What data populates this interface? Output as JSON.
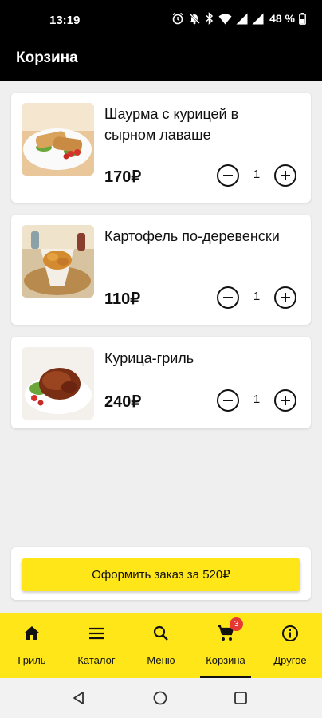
{
  "status": {
    "time": "13:19",
    "battery": "48 %"
  },
  "appbar": {
    "title": "Корзина"
  },
  "cart": {
    "items": [
      {
        "name": "Шаурма с курицей в сырном лаваше",
        "price": "170₽",
        "qty": "1"
      },
      {
        "name": "Картофель по-деревенски",
        "price": "110₽",
        "qty": "1"
      },
      {
        "name": "Курица-гриль",
        "price": "240₽",
        "qty": "1"
      }
    ],
    "checkout_label": "Оформить заказ за 520₽"
  },
  "nav": {
    "items": [
      {
        "label": "Гриль",
        "icon": "home-icon"
      },
      {
        "label": "Каталог",
        "icon": "menu-lines-icon"
      },
      {
        "label": "Меню",
        "icon": "search-icon"
      },
      {
        "label": "Корзина",
        "icon": "cart-icon",
        "badge": "3",
        "active": true
      },
      {
        "label": "Другое",
        "icon": "info-icon"
      }
    ]
  },
  "colors": {
    "accent": "#ffe619",
    "appbar": "#000000",
    "badge": "#e53935"
  }
}
